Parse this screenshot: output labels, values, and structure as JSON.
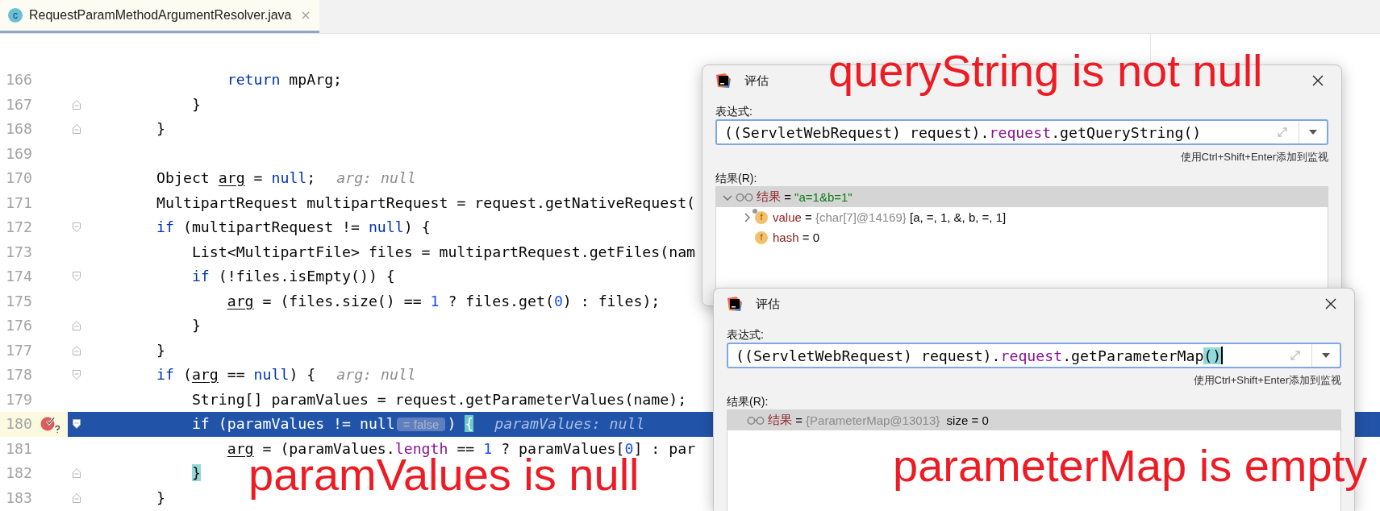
{
  "tab": {
    "icon_letter": "c",
    "filename": "RequestParamMethodArgumentResolver.java",
    "selected": true
  },
  "editor": {
    "lines": [
      {
        "number": "166",
        "fold_start": false,
        "fold_end": false,
        "current": false,
        "breakpoint": false,
        "tokens": [
          {
            "text": "                return",
            "kind": "keyword"
          },
          {
            "text": " mpArg;",
            "kind": "plain"
          }
        ]
      },
      {
        "number": "167",
        "fold_start": false,
        "fold_end": true,
        "current": false,
        "breakpoint": false,
        "tokens": [
          {
            "text": "            }",
            "kind": "plain"
          }
        ]
      },
      {
        "number": "168",
        "fold_start": false,
        "fold_end": true,
        "current": false,
        "breakpoint": false,
        "tokens": [
          {
            "text": "        }",
            "kind": "plain"
          }
        ]
      },
      {
        "number": "169",
        "fold_start": false,
        "fold_end": false,
        "current": false,
        "breakpoint": false
      },
      {
        "number": "170",
        "fold_start": false,
        "fold_end": false,
        "current": false,
        "breakpoint": false,
        "tokens": [
          {
            "text": "        Object ",
            "kind": "plain"
          },
          {
            "text": "arg",
            "kind": "reassigned"
          },
          {
            "text": " = ",
            "kind": "plain"
          },
          {
            "text": "null",
            "kind": "keyword"
          },
          {
            "text": ";",
            "kind": "plain"
          }
        ],
        "hint": "arg: null"
      },
      {
        "number": "171",
        "fold_start": false,
        "fold_end": false,
        "current": false,
        "breakpoint": false,
        "tokens": [
          {
            "text": "        MultipartRequest multipartRequest = request.getNativeRequest(",
            "kind": "plain"
          }
        ]
      },
      {
        "number": "172",
        "fold_start": true,
        "fold_end": false,
        "current": false,
        "breakpoint": false,
        "tokens": [
          {
            "text": "        if",
            "kind": "keyword"
          },
          {
            "text": " (multipartRequest != ",
            "kind": "plain"
          },
          {
            "text": "null",
            "kind": "keyword"
          },
          {
            "text": ") {",
            "kind": "plain"
          }
        ]
      },
      {
        "number": "173",
        "fold_start": false,
        "fold_end": false,
        "current": false,
        "breakpoint": false,
        "tokens": [
          {
            "text": "            List<MultipartFile> files = multipartRequest.getFiles(nam",
            "kind": "plain"
          }
        ]
      },
      {
        "number": "174",
        "fold_start": true,
        "fold_end": false,
        "current": false,
        "breakpoint": false,
        "tokens": [
          {
            "text": "            if",
            "kind": "keyword"
          },
          {
            "text": " (!files.isEmpty()) {",
            "kind": "plain"
          }
        ]
      },
      {
        "number": "175",
        "fold_start": false,
        "fold_end": false,
        "current": false,
        "breakpoint": false,
        "tokens": [
          {
            "text": "                arg",
            "kind": "reassigned"
          },
          {
            "text": " = (files.size() == ",
            "kind": "plain"
          },
          {
            "text": "1",
            "kind": "number"
          },
          {
            "text": " ? files.get(",
            "kind": "plain"
          },
          {
            "text": "0",
            "kind": "number"
          },
          {
            "text": ") : files);",
            "kind": "plain"
          }
        ]
      },
      {
        "number": "176",
        "fold_start": false,
        "fold_end": true,
        "current": false,
        "breakpoint": false,
        "tokens": [
          {
            "text": "            }",
            "kind": "plain"
          }
        ]
      },
      {
        "number": "177",
        "fold_start": false,
        "fold_end": true,
        "current": false,
        "breakpoint": false,
        "tokens": [
          {
            "text": "        }",
            "kind": "plain"
          }
        ]
      },
      {
        "number": "178",
        "fold_start": true,
        "fold_end": false,
        "current": false,
        "breakpoint": false,
        "tokens": [
          {
            "text": "        if",
            "kind": "keyword"
          },
          {
            "text": " (",
            "kind": "plain"
          },
          {
            "text": "arg",
            "kind": "reassigned"
          },
          {
            "text": " == ",
            "kind": "plain"
          },
          {
            "text": "null",
            "kind": "keyword"
          },
          {
            "text": ") {",
            "kind": "plain"
          }
        ],
        "hint": "arg: null"
      },
      {
        "number": "179",
        "fold_start": false,
        "fold_end": false,
        "current": false,
        "breakpoint": false,
        "tokens": [
          {
            "text": "            String[] paramValues = request.getParameterValues(name);",
            "kind": "plain"
          }
        ]
      },
      {
        "number": "180",
        "fold_start": true,
        "fold_end": false,
        "current": true,
        "breakpoint": true,
        "tokens": [
          {
            "text": "            if",
            "kind": "keyword"
          },
          {
            "text": " (paramValues != ",
            "kind": "plain"
          },
          {
            "text": "null",
            "kind": "keyword"
          },
          {
            "text": "= false",
            "kind": "inlay"
          },
          {
            "text": ") ",
            "kind": "plain"
          },
          {
            "text": "{",
            "kind": "match"
          }
        ],
        "hint": "paramValues: null"
      },
      {
        "number": "181",
        "fold_start": false,
        "fold_end": false,
        "current": false,
        "breakpoint": false,
        "tokens": [
          {
            "text": "                arg",
            "kind": "reassigned"
          },
          {
            "text": " = (paramValues.",
            "kind": "plain"
          },
          {
            "text": "length",
            "kind": "field"
          },
          {
            "text": " == ",
            "kind": "plain"
          },
          {
            "text": "1",
            "kind": "number"
          },
          {
            "text": " ? paramValues[",
            "kind": "plain"
          },
          {
            "text": "0",
            "kind": "number"
          },
          {
            "text": "] : par",
            "kind": "plain"
          }
        ]
      },
      {
        "number": "182",
        "fold_start": false,
        "fold_end": true,
        "current": false,
        "breakpoint": false,
        "tokens": [
          {
            "text": "            }",
            "kind": "match"
          }
        ]
      },
      {
        "number": "183",
        "fold_start": false,
        "fold_end": true,
        "current": false,
        "breakpoint": false,
        "tokens": [
          {
            "text": "        }",
            "kind": "plain"
          }
        ]
      }
    ]
  },
  "dialogs": [
    {
      "title": "评估",
      "expression_label": "表达式:",
      "expression": [
        {
          "text": "((ServletWebRequest) request).",
          "kind": "plain"
        },
        {
          "text": "request",
          "kind": "field"
        },
        {
          "text": ".getQueryString()",
          "kind": "plain"
        }
      ],
      "cursor": false,
      "shortcut_hint": "使用Ctrl+Shift+Enter添加到监视",
      "result_label": "结果(R):",
      "results": [
        {
          "kind": "watch",
          "expandable": true,
          "expanded": true,
          "selected": true,
          "tokens": [
            {
              "text": "结果",
              "kind": "name"
            },
            {
              "text": " = ",
              "kind": "plain"
            },
            {
              "text": "\"a=1&b=1\"",
              "kind": "string"
            }
          ],
          "children": [
            {
              "kind": "field",
              "icon_glyph": "f",
              "expandable": true,
              "expanded": false,
              "selected": false,
              "badge": true,
              "tokens": [
                {
                  "text": "value",
                  "kind": "name"
                },
                {
                  "text": " = ",
                  "kind": "plain"
                },
                {
                  "text": "{char[7]@14169}",
                  "kind": "ref"
                },
                {
                  "text": " [a, =, 1, &, b, =, 1]",
                  "kind": "plain"
                }
              ]
            },
            {
              "kind": "field",
              "icon_glyph": "f",
              "expandable": false,
              "selected": false,
              "tokens": [
                {
                  "text": "hash",
                  "kind": "name"
                },
                {
                  "text": " = 0",
                  "kind": "plain"
                }
              ]
            }
          ]
        }
      ]
    },
    {
      "title": "评估",
      "expression_label": "表达式:",
      "expression": [
        {
          "text": "((ServletWebRequest) request).",
          "kind": "plain"
        },
        {
          "text": "request",
          "kind": "field"
        },
        {
          "text": ".getParameterMap",
          "kind": "plain"
        },
        {
          "text": "()",
          "kind": "match"
        }
      ],
      "cursor": true,
      "shortcut_hint": "使用Ctrl+Shift+Enter添加到监视",
      "result_label": "结果(R):",
      "results": [
        {
          "kind": "watch",
          "expandable": false,
          "selected": true,
          "tokens": [
            {
              "text": "结果",
              "kind": "name"
            },
            {
              "text": " = ",
              "kind": "plain"
            },
            {
              "text": "{ParameterMap@13013}",
              "kind": "ref"
            },
            {
              "text": "  size = 0",
              "kind": "plain"
            }
          ]
        }
      ]
    }
  ],
  "annotations": [
    {
      "text": "queryString is not null"
    },
    {
      "text": "paramValues is null"
    },
    {
      "text": "parameterMap is empty"
    }
  ]
}
